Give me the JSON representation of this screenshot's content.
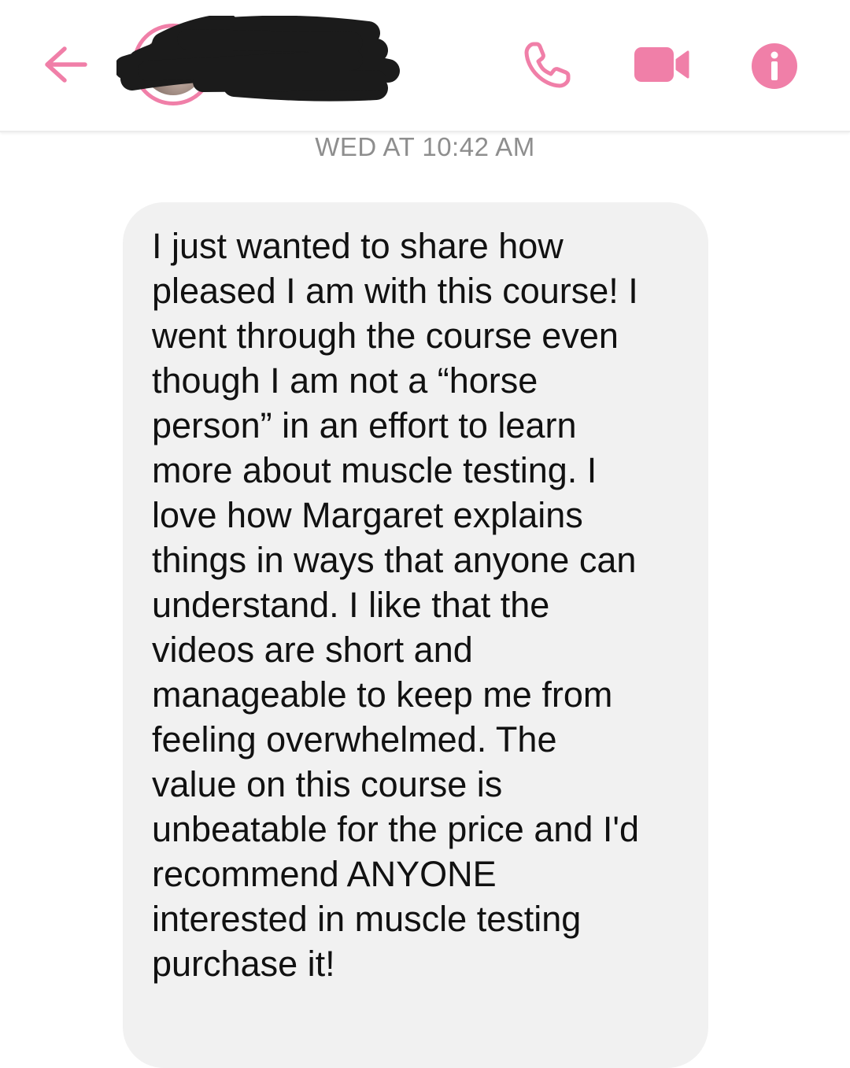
{
  "header": {
    "contact_name": "",
    "accent_color": "#f07fa8",
    "icons": {
      "back": "arrow-left-icon",
      "call": "phone-icon",
      "video": "video-camera-icon",
      "info": "info-icon"
    }
  },
  "conversation": {
    "timestamp": "WED AT 10:42 AM",
    "messages": [
      {
        "sender": "contact",
        "text": "I just wanted to share how\npleased I am with this course! I\nwent through the course even\nthough I am not a “horse\nperson” in an effort to learn\nmore about muscle testing. I\nlove how Margaret explains\nthings in ways that anyone can\nunderstand. I like that the\nvideos are short and\nmanageable to keep me from\nfeeling overwhelmed. The\nvalue on this course is\nunbeatable for the price and I'd\nrecommend ANYONE\ninterested in muscle testing\npurchase it!"
      }
    ]
  }
}
